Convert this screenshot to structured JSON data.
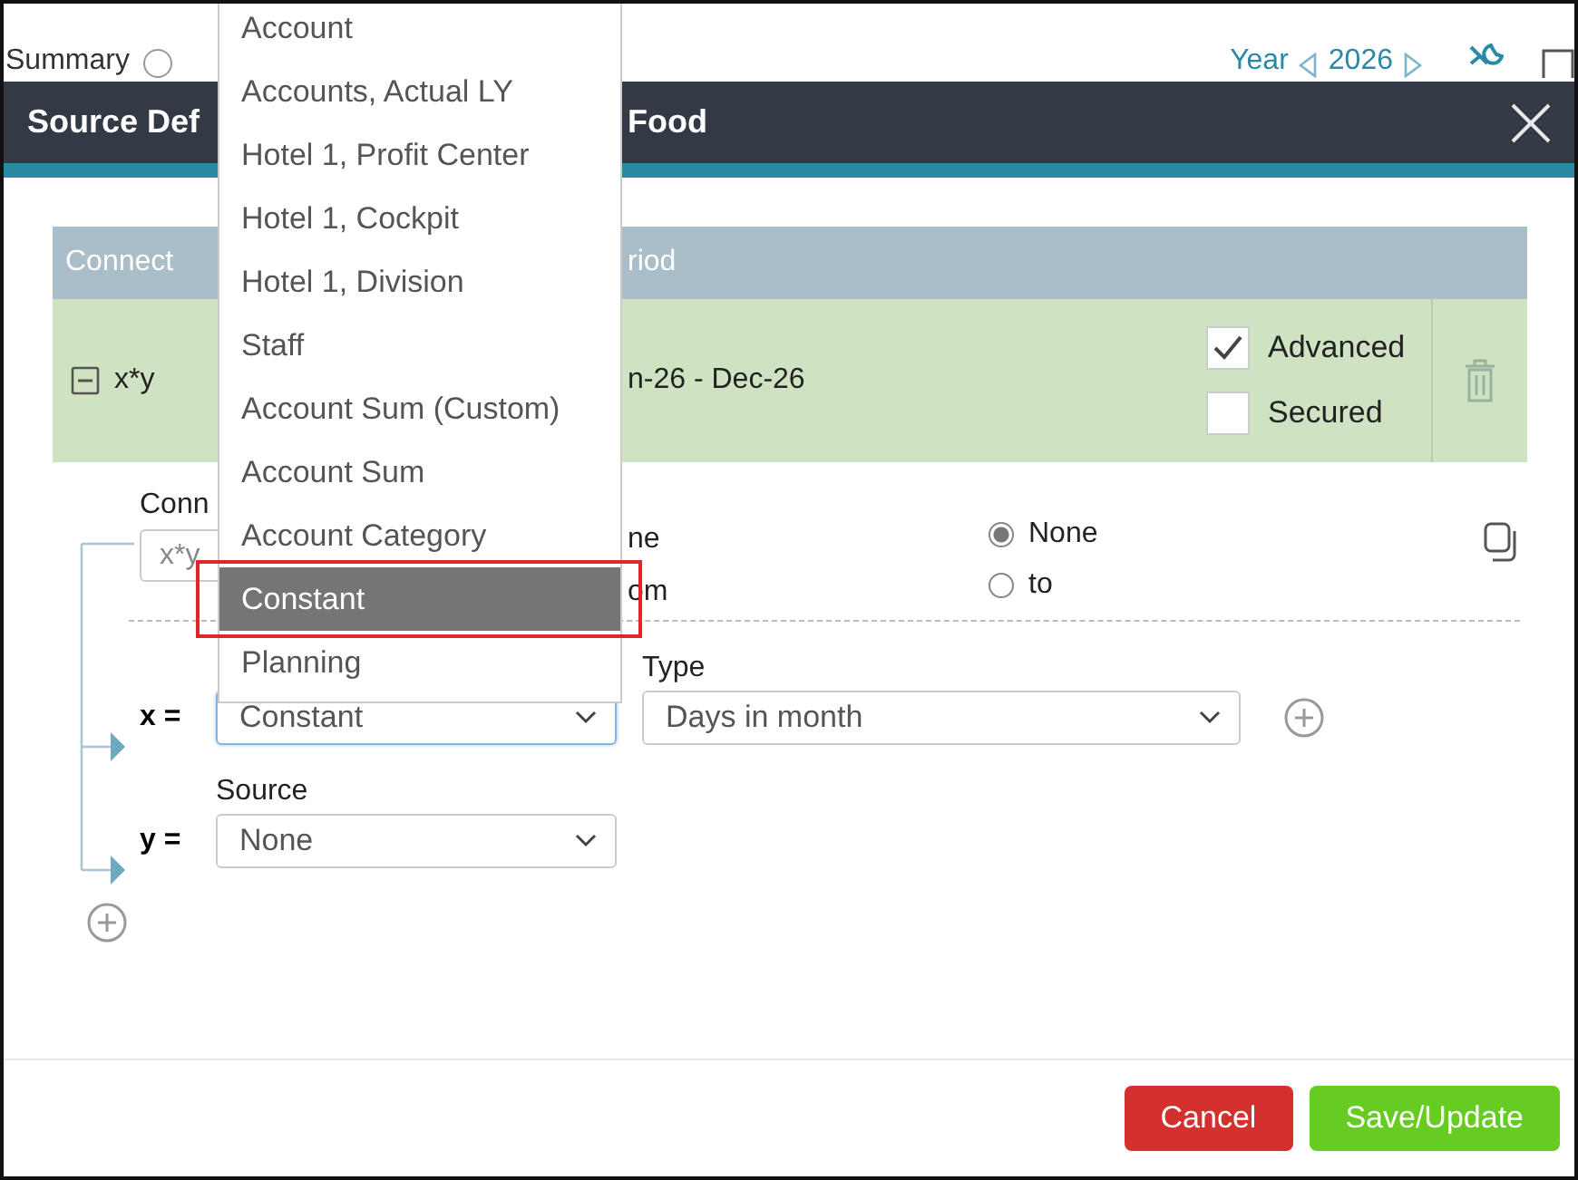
{
  "background": {
    "summary_label": "Summary",
    "year_label": "Year",
    "year_value": "2026",
    "radio_selected": false
  },
  "dialog": {
    "title_parts": [
      "Source Def",
      "Food"
    ]
  },
  "table": {
    "columns": [
      "Connect",
      "riod"
    ],
    "row": {
      "expanded": true,
      "formula": "x*y",
      "period": "n-26 - Dec-26",
      "options": [
        {
          "label": "Advanced",
          "checked": true
        },
        {
          "label": "Secured",
          "checked": false
        }
      ]
    }
  },
  "connection": {
    "label": "Conn",
    "value": "x*y",
    "option_labels": [
      "ne",
      "om"
    ],
    "radios": [
      {
        "label": "None",
        "selected": true
      },
      {
        "label": "to",
        "selected": false
      }
    ]
  },
  "variables": [
    {
      "name": "x =",
      "source": "Constant",
      "focused": true,
      "type_label": "Type",
      "type": "Days in month"
    },
    {
      "name": "y =",
      "source_label": "Source",
      "source": "None",
      "focused": false
    }
  ],
  "dropdown": {
    "items": [
      {
        "label": "Account",
        "selected": false
      },
      {
        "label": "Accounts, Actual LY",
        "selected": false
      },
      {
        "label": "Hotel 1, Profit Center",
        "selected": false
      },
      {
        "label": "Hotel 1, Cockpit",
        "selected": false
      },
      {
        "label": "Hotel 1, Division",
        "selected": false
      },
      {
        "label": "Staff",
        "selected": false
      },
      {
        "label": "Account Sum (Custom)",
        "selected": false
      },
      {
        "label": "Account Sum",
        "selected": false
      },
      {
        "label": "Account Category",
        "selected": false
      },
      {
        "label": "Constant",
        "selected": true
      },
      {
        "label": "Planning",
        "selected": false
      }
    ]
  },
  "buttons": [
    {
      "label": "Cancel",
      "kind": "cancel"
    },
    {
      "label": "Save/Update",
      "kind": "save"
    }
  ]
}
